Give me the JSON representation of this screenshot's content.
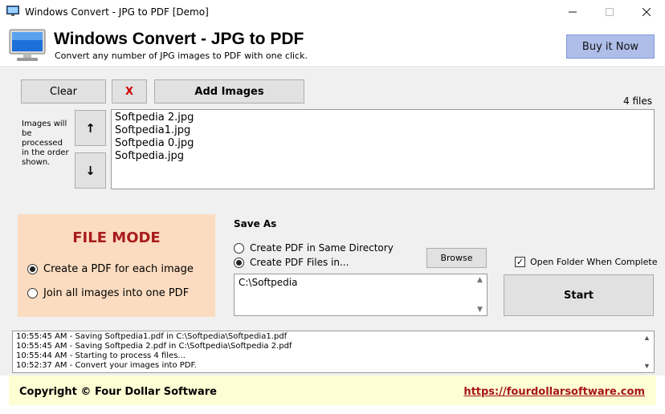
{
  "window": {
    "title": "Windows Convert - JPG to PDF [Demo]",
    "controls": {
      "minimize": "—",
      "maximize": "☐",
      "close": "✕"
    }
  },
  "header": {
    "title": "Windows Convert - JPG to PDF",
    "subtitle": "Convert any number of JPG images to PDF with one click.",
    "buy_label": "Buy it Now",
    "accent_color": "#aebee9"
  },
  "toolbar": {
    "clear_label": "Clear",
    "remove_label": "X",
    "add_label": "Add Images",
    "file_count": "4 files"
  },
  "order": {
    "note": "Images will be processed in the order shown.",
    "up_label": "↑",
    "down_label": "↓"
  },
  "files": [
    "Softpedia 2.jpg",
    "Softpedia1.jpg",
    "Softpedia 0.jpg",
    "Softpedia.jpg"
  ],
  "file_mode": {
    "title": "FILE MODE",
    "option_each": "Create a PDF for each image",
    "option_all": "Join all images into one PDF",
    "selected": "each",
    "bg_color": "#fbdcc0"
  },
  "save_as": {
    "label": "Save As",
    "option_same": "Create PDF in Same Directory",
    "option_in": "Create PDF Files in...",
    "selected": "in",
    "browse_label": "Browse",
    "directory": "C:\\Softpedia"
  },
  "open_folder": {
    "label": "Open Folder When Complete",
    "checked": true
  },
  "start_label": "Start",
  "log": [
    "10:55:45 AM - Saving Softpedia1.pdf in C:\\Softpedia\\Softpedia1.pdf",
    "10:55:45 AM - Saving Softpedia 2.pdf in C:\\Softpedia\\Softpedia 2.pdf",
    "10:55:44 AM - Starting to process 4 files...",
    "10:52:37 AM - Convert your images into PDF."
  ],
  "footer": {
    "copyright": "Copyright © Four Dollar Software",
    "link": "https://fourdollarsoftware.com",
    "link_color": "#a51515"
  }
}
